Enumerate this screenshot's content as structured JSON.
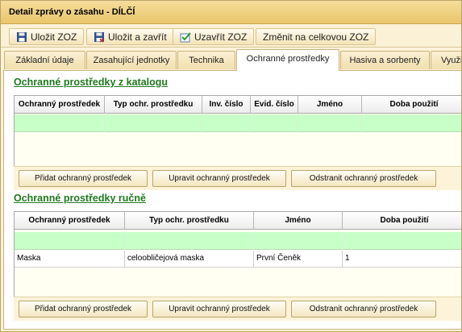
{
  "window": {
    "title": "Detail zprávy o zásahu - DÍLČÍ"
  },
  "toolbar": {
    "save_zoz": "Uložit ZOZ",
    "save_close": "Uložit a zavřít",
    "close_zoz": "Uzavřít ZOZ",
    "change_full": "Změnit na celkovou ZOZ"
  },
  "tabs": [
    {
      "label": "Základní údaje"
    },
    {
      "label": "Zasahující jednotky"
    },
    {
      "label": "Technika"
    },
    {
      "label": "Ochranné prostředky"
    },
    {
      "label": "Hasiva a sorbenty"
    },
    {
      "label": "Využi"
    }
  ],
  "catalog": {
    "title": "Ochranné prostředky z katalogu",
    "columns": [
      "Ochranný prostředek",
      "Typ ochr. prostředku",
      "Inv. číslo",
      "Evid. číslo",
      "Jméno",
      "Doba použití"
    ],
    "buttons": {
      "add": "Přidat ochranný prostředek",
      "edit": "Upravit ochranný prostředek",
      "remove": "Odstranit ochranný prostředek"
    }
  },
  "manual": {
    "title": "Ochranné prostředky ručně",
    "columns": [
      "Ochranný prostředek",
      "Typ ochr. prostředku",
      "Jméno",
      "Doba použití"
    ],
    "rows": [
      [
        "Maska",
        "celoobličejová maska",
        "První Čeněk",
        "1"
      ]
    ],
    "buttons": {
      "add": "Přidat ochranný prostředek",
      "edit": "Upravit ochranný prostředek",
      "remove": "Odstranit ochranný prostředek"
    }
  },
  "colors": {
    "accent_green": "#1f7a1f",
    "filter_row": "#c8ffc8",
    "window_bg": "#fdf3d9"
  },
  "icons": {
    "save": "floppy-disk-icon",
    "save_close": "floppy-disk-close-icon",
    "close_zoz": "checkbox-check-icon"
  }
}
